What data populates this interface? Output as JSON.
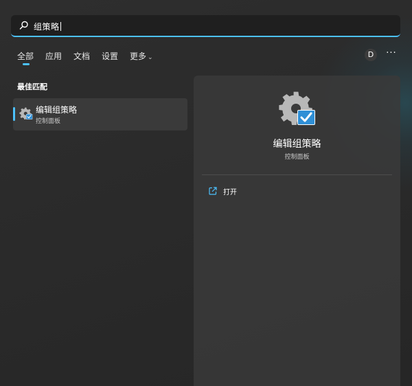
{
  "search": {
    "query": "组策略",
    "icon": "search-icon"
  },
  "tabs": [
    {
      "label": "全部",
      "active": true
    },
    {
      "label": "应用"
    },
    {
      "label": "文档"
    },
    {
      "label": "设置"
    },
    {
      "label": "更多"
    }
  ],
  "account": {
    "avatar_letter": "D"
  },
  "more_options": {
    "label": "···"
  },
  "best_match": {
    "section_label": "最佳匹配",
    "title": "编辑组策略",
    "subtitle": "控制面板",
    "icon": "gear-checkmark-icon"
  },
  "detail": {
    "title": "编辑组策略",
    "subtitle": "控制面板",
    "icon": "gear-checkmark-icon",
    "actions": [
      {
        "label": "打开",
        "icon": "open-external-icon"
      }
    ]
  },
  "colors": {
    "accent": "#4cc2ff",
    "background": "#2b2b2b",
    "panel": "#3a3a3a",
    "search_bg": "#1f1f1f"
  }
}
